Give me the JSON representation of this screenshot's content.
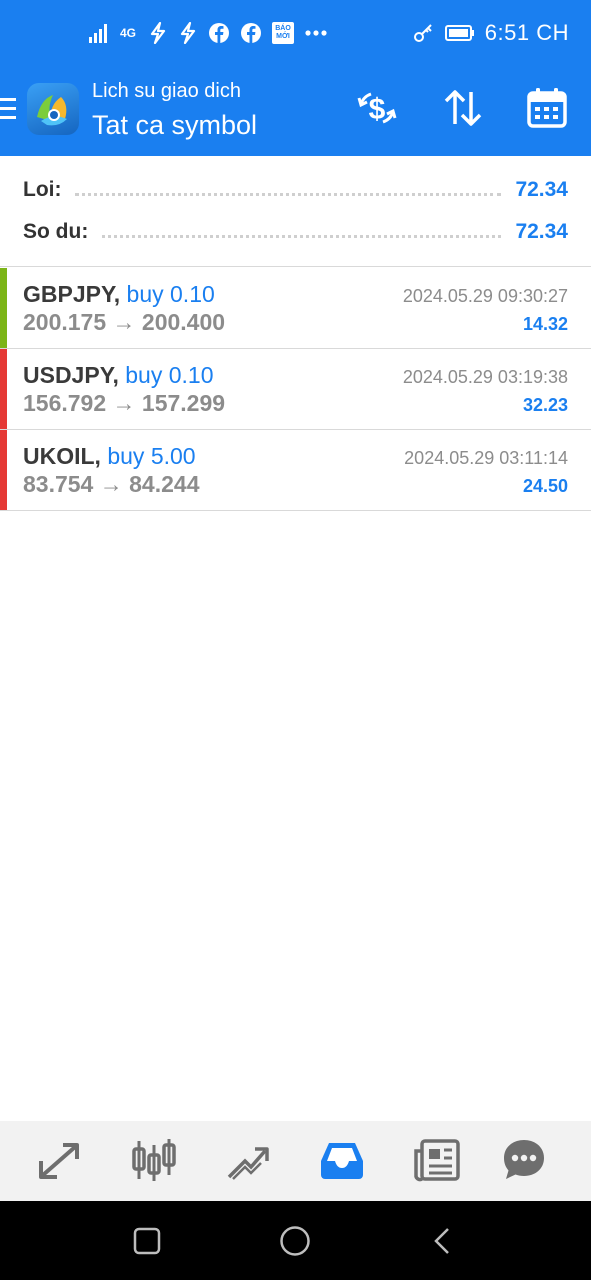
{
  "status_bar": {
    "network": "4G",
    "time": "6:51 CH",
    "notification_icons": [
      "signal-icon",
      "4g-icon",
      "flash-icon",
      "flash-icon",
      "facebook-icon",
      "facebook-icon",
      "baomoi-icon",
      "more-dots-icon"
    ],
    "right_icons": [
      "key-icon",
      "battery-icon"
    ],
    "baomoi_label": "BÁO MỚI"
  },
  "toolbar": {
    "subtitle": "Lich su giao dich",
    "title": "Tat ca symbol",
    "buttons": [
      "currency-exchange-icon",
      "sort-icon",
      "calendar-icon"
    ]
  },
  "summary": {
    "profit_label": "Loi:",
    "profit_value": "72.34",
    "balance_label": "So du:",
    "balance_value": "72.34"
  },
  "trades": [
    {
      "symbol": "GBPJPY,",
      "direction": "buy 0.10",
      "open_price": "200.175",
      "arrow": "→",
      "close_price": "200.400",
      "time": "2024.05.29 09:30:27",
      "profit": "14.32",
      "indicator_color": "#7cb518"
    },
    {
      "symbol": "USDJPY,",
      "direction": "buy 0.10",
      "open_price": "156.792",
      "arrow": "→",
      "close_price": "157.299",
      "time": "2024.05.29 03:19:38",
      "profit": "32.23",
      "indicator_color": "#e53935"
    },
    {
      "symbol": "UKOIL,",
      "direction": "buy 5.00",
      "open_price": "83.754",
      "arrow": "→",
      "close_price": "84.244",
      "time": "2024.05.29 03:11:14",
      "profit": "24.50",
      "indicator_color": "#e53935"
    }
  ],
  "bottom_nav": {
    "items": [
      "quotes-icon",
      "chart-icon",
      "trade-icon",
      "history-icon",
      "news-icon",
      "messages-icon"
    ],
    "active": "history-icon"
  },
  "colors": {
    "accent": "#1a7ff0",
    "inactive_icon": "#6e6e6e"
  }
}
